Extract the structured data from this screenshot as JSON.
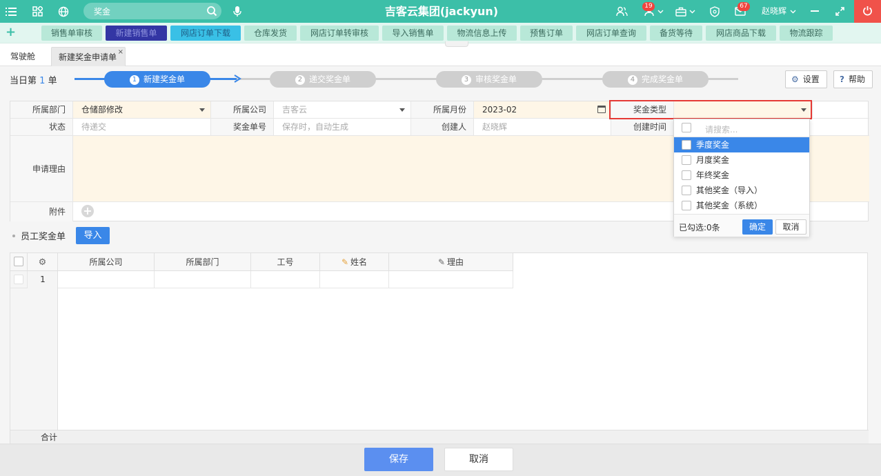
{
  "topbar": {
    "search_text": "奖金",
    "app_title": "吉客云集团(jackyun)",
    "team_badge": "19",
    "msg_badge": "67",
    "username": "赵晓辉",
    "accent": "#3cbfa8"
  },
  "quickbar": {
    "items": [
      "销售单审核",
      "新建销售单",
      "网店订单下载",
      "仓库发货",
      "网店订单转审核",
      "导入销售单",
      "物流信息上传",
      "预售订单",
      "网店订单查询",
      "备货等待",
      "网店商品下载",
      "物流跟踪"
    ]
  },
  "tabs": [
    "驾驶舱",
    "新建奖金申请单"
  ],
  "tab_close": "×",
  "header": {
    "day_prefix": "当日第",
    "day_num": "1",
    "day_suffix": "单",
    "steps": [
      {
        "n": "1",
        "label": "新建奖金单"
      },
      {
        "n": "2",
        "label": "递交奖金单"
      },
      {
        "n": "3",
        "label": "审核奖金单"
      },
      {
        "n": "4",
        "label": "完成奖金单"
      }
    ],
    "settings_label": "设置",
    "help_label": "帮助"
  },
  "form": {
    "dept_label": "所属部门",
    "dept_value": "仓储部修改",
    "company_label": "所属公司",
    "company_value": "吉客云",
    "month_label": "所属月份",
    "month_value": "2023-02",
    "bonus_type_label": "奖金类型",
    "bonus_type_value": "",
    "status_label": "状态",
    "status_value": "待递交",
    "bonus_no_label": "奖金单号",
    "bonus_no_value": "保存时，自动生成",
    "creator_label": "创建人",
    "creator_value": "赵晓辉",
    "create_time_label": "创建时间",
    "create_time_value": "",
    "reason_label": "申请理由",
    "attach_label": "附件",
    "attach_add": "+"
  },
  "dropdown": {
    "search_placeholder": "请搜索...",
    "options": [
      "季度奖金",
      "月度奖金",
      "年终奖金",
      "其他奖金（导入）",
      "其他奖金（系统）"
    ],
    "selected_text": "已勾选:0条",
    "ok_label": "确定",
    "cancel_label": "取消"
  },
  "employee": {
    "section_title": "员工奖金单",
    "import_label": "导入",
    "columns": [
      "所属公司",
      "所属部门",
      "工号",
      "姓名",
      "理由"
    ],
    "rows": [
      {
        "index": "1"
      }
    ],
    "total_label": "合计"
  },
  "footer": {
    "save_label": "保存",
    "cancel_label": "取消"
  }
}
